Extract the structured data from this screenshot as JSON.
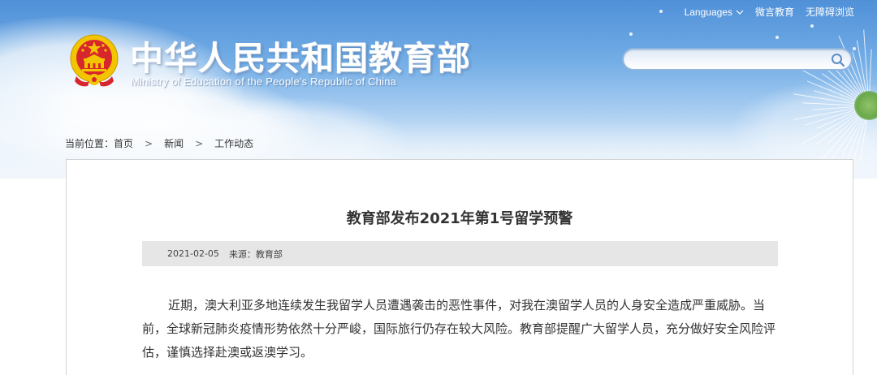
{
  "top_links": {
    "languages": "Languages",
    "weibo": "微言教育",
    "accessible": "无障碍浏览"
  },
  "header": {
    "title": "中华人民共和国教育部",
    "subtitle": "Ministry of Education of the People's Republic of China"
  },
  "search": {
    "placeholder": ""
  },
  "breadcrumb": {
    "label": "当前位置：",
    "items": [
      "首页",
      "新闻",
      "工作动态"
    ]
  },
  "article": {
    "title": "教育部发布2021年第1号留学预警",
    "date": "2021-02-05",
    "source": "来源：教育部",
    "paragraph": "近期，澳大利亚多地连续发生我留学人员遭遇袭击的恶性事件，对我在澳留学人员的人身安全造成严重威胁。当前，全球新冠肺炎疫情形势依然十分严峻，国际旅行仍存在较大风险。教育部提醒广大留学人员，充分做好安全风险评估，谨慎选择赴澳或返澳学习。"
  },
  "colors": {
    "header_blue": "#4f90d8",
    "emblem_red": "#d8262d",
    "emblem_gold": "#f2c500",
    "meta_bar": "#e6e6e6"
  }
}
